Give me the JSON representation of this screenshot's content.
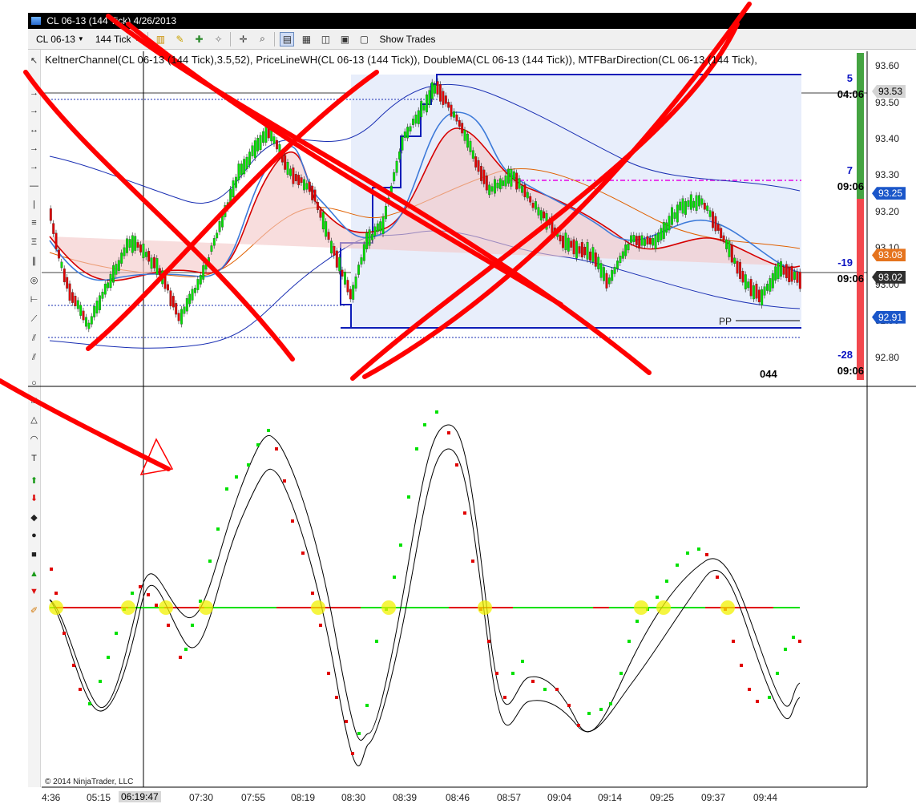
{
  "window": {
    "title": "CL 06-13 (144 Tick)  4/26/2013"
  },
  "toolbar": {
    "instrument": "CL 06-13",
    "interval": "144 Tick",
    "show_trades_label": "Show Trades"
  },
  "indicators_label": "KeltnerChannel(CL 06-13 (144 Tick),3.5,52),  PriceLineWH(CL 06-13 (144 Tick)),  DoubleMA(CL 06-13 (144 Tick)),  MTFBarDirection(CL 06-13 (144 Tick),",
  "price_axis": {
    "ticks": [
      "93.60",
      "93.50",
      "93.40",
      "93.30",
      "93.20",
      "93.10",
      "93.00",
      "92.90",
      "92.80"
    ],
    "ylim": [
      92.72,
      93.64
    ]
  },
  "price_tags": [
    {
      "value": "93.53",
      "bg": "#d4d4d4",
      "fg": "#000000"
    },
    {
      "value": "93.25",
      "bg": "#1a56c9",
      "fg": "#ffffff"
    },
    {
      "value": "93.08",
      "bg": "#e5731d",
      "fg": "#ffffff"
    },
    {
      "value": "93.02",
      "bg": "#2f2f2f",
      "fg": "#ffffff"
    },
    {
      "value": "92.91",
      "bg": "#1a56c9",
      "fg": "#ffffff"
    }
  ],
  "mtf_direction": [
    {
      "num": "5",
      "time": "04:06",
      "color": "#0a12c2"
    },
    {
      "num": "7",
      "time": "09:06",
      "color": "#0a12c2"
    },
    {
      "num": "-19",
      "time": "09:06",
      "color": "#0a12c2"
    },
    {
      "num": "-28",
      "time": "09:06",
      "color": "#0a12c2"
    }
  ],
  "pp_label": "PP",
  "bar_count": "044",
  "time_axis": {
    "ticks": [
      "4:36",
      "05:15",
      "07:30",
      "07:55",
      "08:19",
      "08:30",
      "08:39",
      "08:46",
      "08:57",
      "09:04",
      "09:14",
      "09:25",
      "09:37",
      "09:44"
    ],
    "cursor_time": "06:19:47"
  },
  "copyright": "© 2014 NinjaTrader, LLC",
  "colors": {
    "bull": "#00e000",
    "bear": "#e00000",
    "channel": "#1a2fb3",
    "annotation": "#ff0000",
    "pp_box": "#0d1db8"
  },
  "icons": {
    "instrument_caret": "chevron-down-icon",
    "bar_type": "candlestick-icon",
    "draw": "pencil-icon",
    "crosshair": "crosshair-icon",
    "zoom": "magnifier-icon"
  }
}
